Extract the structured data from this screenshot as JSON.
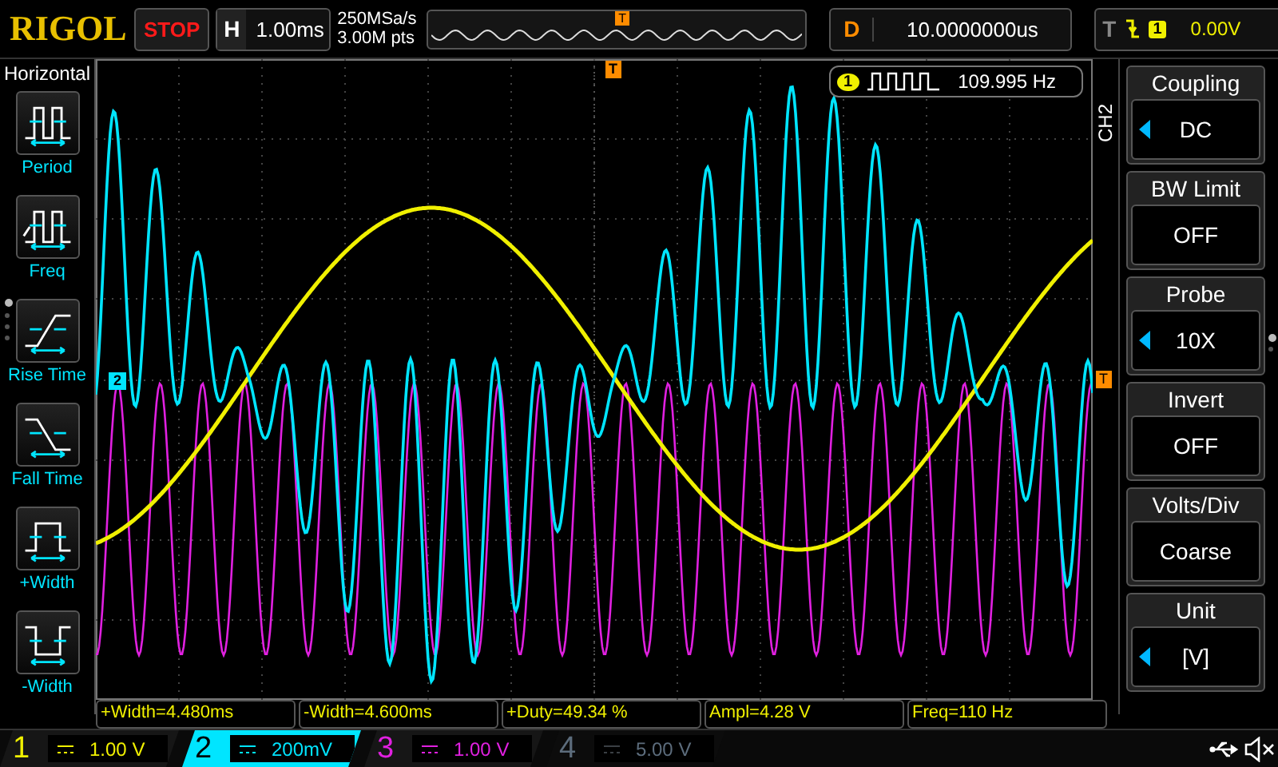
{
  "header": {
    "logo": "RIGOL",
    "run_state": "STOP",
    "timebase": {
      "label": "H",
      "value": "1.00ms"
    },
    "sample_rate": "250MSa/s",
    "memory_depth": "3.00M pts",
    "overview_marker": "T",
    "delay": {
      "label": "D",
      "value": "10.0000000us"
    },
    "trigger": {
      "label": "T",
      "source": "1",
      "level": "0.00V"
    }
  },
  "left_menu": {
    "title": "Horizontal",
    "page_dots": [
      {
        "selected": true
      },
      {
        "selected": false
      },
      {
        "selected": false
      },
      {
        "selected": false
      }
    ],
    "items": [
      {
        "kind": "period",
        "label": "Period"
      },
      {
        "kind": "freq",
        "label": "Freq"
      },
      {
        "kind": "rise",
        "label": "Rise Time"
      },
      {
        "kind": "fall",
        "label": "Fall Time"
      },
      {
        "kind": "pwidth",
        "label": "+Width"
      },
      {
        "kind": "nwidth",
        "label": "-Width"
      }
    ]
  },
  "plot": {
    "trigger_position_marker": "T",
    "trigger_level_marker": "T",
    "channel_offset_marker": "2",
    "counter": {
      "source": "1",
      "frequency": "109.995 Hz"
    }
  },
  "right_menu": {
    "title": "CH2",
    "page_dots": [
      {
        "selected": true
      },
      {
        "selected": false
      }
    ],
    "items": [
      {
        "label": "Coupling",
        "value": "DC",
        "adjustable": true
      },
      {
        "label": "BW Limit",
        "value": "OFF",
        "adjustable": false
      },
      {
        "label": "Probe",
        "value": "10X",
        "adjustable": true
      },
      {
        "label": "Invert",
        "value": "OFF",
        "adjustable": false
      },
      {
        "label": "Volts/Div",
        "value": "Coarse",
        "adjustable": false
      },
      {
        "label": "Unit",
        "value": "[V]",
        "adjustable": true
      }
    ]
  },
  "measurements": [
    "+Width=4.480ms",
    "-Width=4.600ms",
    "+Duty=49.34 %",
    "Ampl=4.28 V",
    "Freq=110 Hz"
  ],
  "channels": [
    {
      "number": "1",
      "scale": "1.00 V",
      "color": "#f0f000",
      "enabled": true,
      "selected": false
    },
    {
      "number": "2",
      "scale": "200mV",
      "color": "#00e5ff",
      "enabled": true,
      "selected": true
    },
    {
      "number": "3",
      "scale": "1.00 V",
      "color": "#e020e0",
      "enabled": true,
      "selected": false
    },
    {
      "number": "4",
      "scale": "5.00 V",
      "color": "#5c6c7c",
      "enabled": false,
      "selected": false
    }
  ]
}
